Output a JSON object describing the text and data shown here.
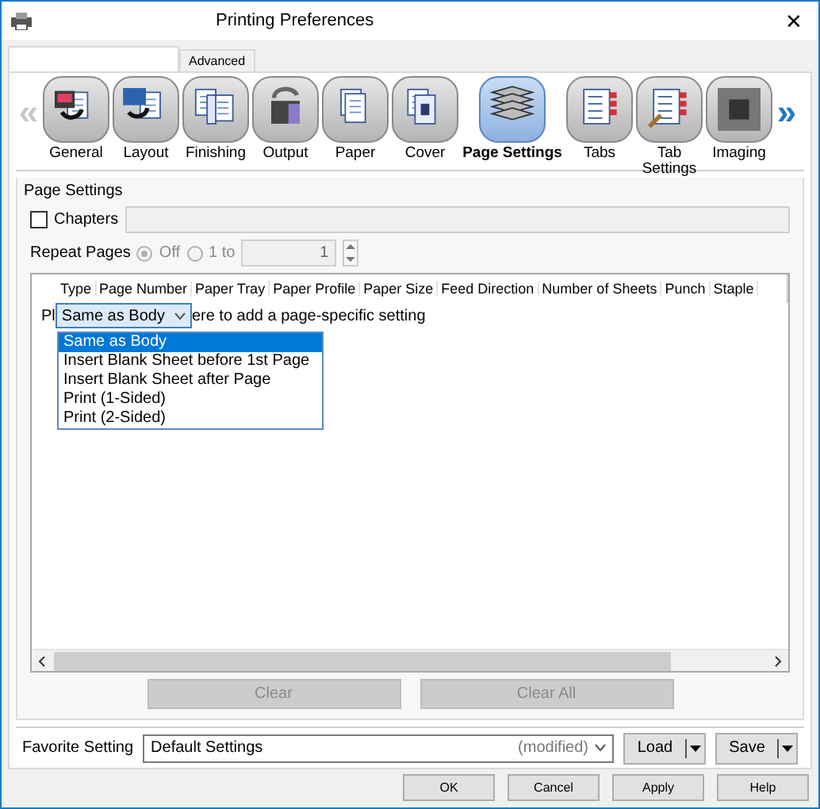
{
  "window": {
    "title": "Printing Preferences",
    "close": "✕"
  },
  "tabs": [
    {
      "selected": true
    },
    {
      "label": "Advanced",
      "selected": false
    }
  ],
  "nav": {
    "prev": "«",
    "next": "»",
    "prev_disabled": true
  },
  "categories": [
    {
      "label": "General",
      "kind": "general",
      "selected": false
    },
    {
      "label": "Layout",
      "kind": "layout",
      "selected": false
    },
    {
      "label": "Finishing",
      "kind": "finishing",
      "selected": false
    },
    {
      "label": "Output",
      "kind": "output",
      "selected": false
    },
    {
      "label": "Paper",
      "kind": "paper",
      "selected": false
    },
    {
      "label": "Cover",
      "kind": "cover",
      "selected": false
    },
    {
      "label": "Page Settings",
      "kind": "stack",
      "selected": true
    },
    {
      "label": "Tabs",
      "kind": "tabs",
      "selected": false
    },
    {
      "label": "Tab Settings",
      "kind": "tabsettings",
      "selected": false
    },
    {
      "label": "Imaging",
      "kind": "imaging",
      "selected": false
    }
  ],
  "group": {
    "title": "Page Settings",
    "chapters": {
      "label": "Chapters",
      "checked": false
    },
    "repeat_pages": {
      "label": "Repeat Pages",
      "options": [
        {
          "label": "Off",
          "selected": true
        },
        {
          "label": "1 to",
          "selected": false
        }
      ],
      "disabled": true,
      "value": "1"
    },
    "table": {
      "columns": [
        "Type",
        "Page Number",
        "Paper Tray",
        "Paper Profile",
        "Paper Size",
        "Feed Direction",
        "Number of Sheets",
        "Punch",
        "Staple"
      ],
      "hint_before": "Pl",
      "hint_after": "ere to add a page-specific setting",
      "combo": {
        "value": "Same as Body",
        "options": [
          {
            "label": "Same as Body",
            "selected": true
          },
          {
            "label": "Insert Blank Sheet before 1st Page",
            "selected": false
          },
          {
            "label": "Insert Blank Sheet after Page",
            "selected": false
          },
          {
            "label": "Print (1-Sided)",
            "selected": false
          },
          {
            "label": "Print (2-Sided)",
            "selected": false
          }
        ]
      }
    },
    "buttons": [
      {
        "label": "Clear",
        "disabled": true
      },
      {
        "label": "Clear All",
        "disabled": true
      }
    ]
  },
  "favorite": {
    "label": "Favorite Setting",
    "value": "Default Settings",
    "suffix": "(modified)",
    "buttons": [
      "Load",
      "Save"
    ]
  },
  "footer_buttons": [
    "OK",
    "Cancel",
    "Apply",
    "Help"
  ]
}
